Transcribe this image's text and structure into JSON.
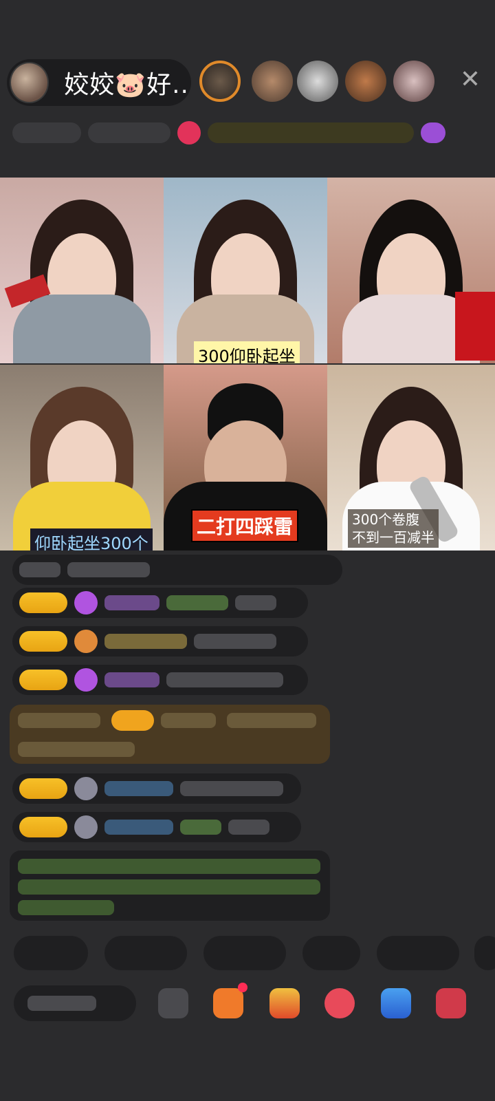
{
  "header": {
    "host_name": "姣姣🐷好...",
    "close_icon": "close-icon"
  },
  "video_grid": {
    "tiles": [
      {
        "caption": ""
      },
      {
        "caption": "300仰卧起坐"
      },
      {
        "caption": ""
      },
      {
        "caption": "仰卧起坐300个"
      },
      {
        "caption": "二打四踩雷"
      },
      {
        "caption": "300个卷腹\n不到一百减半"
      }
    ]
  },
  "colors": {
    "background": "#2b2b2d",
    "badge_gold": "#f0b41e",
    "caption_yellow": "#fff6a8",
    "red_caption_bg": "#e43b1f"
  }
}
